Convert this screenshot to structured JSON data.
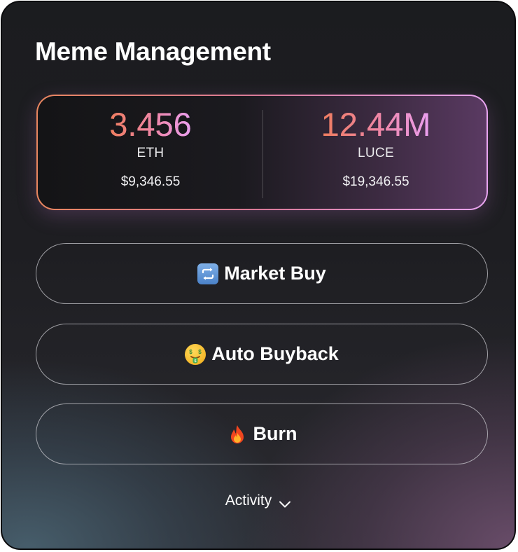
{
  "card": {
    "title": "Meme Management"
  },
  "balances": [
    {
      "amount": "3.456",
      "ticker": "ETH",
      "usd_value": "$9,346.55"
    },
    {
      "amount": "12.44M",
      "ticker": "LUCE",
      "usd_value": "$19,346.55"
    }
  ],
  "actions": [
    {
      "label": "Market Buy",
      "icon": "repeat-icon"
    },
    {
      "label": "Auto Buyback",
      "icon": "money-mouth-face-icon"
    },
    {
      "label": "Burn",
      "icon": "fire-icon"
    }
  ],
  "activity": {
    "label": "Activity",
    "icon": "chevron-down-icon"
  },
  "colors": {
    "accent_start": "#ef7d5e",
    "accent_end": "#eaa0f2",
    "card_background": "#1e1e22",
    "text": "#ffffff"
  }
}
